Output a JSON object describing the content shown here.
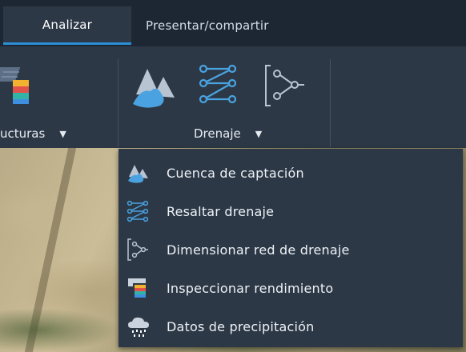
{
  "tabs": [
    {
      "label": "Analizar",
      "active": true
    },
    {
      "label": "Presentar/compartir",
      "active": false
    }
  ],
  "ribbon": {
    "groups": [
      {
        "label": "ucturas",
        "icon": "structures-icon"
      },
      {
        "label": "Drenaje",
        "icon": "drainage-icon"
      }
    ]
  },
  "menu": {
    "items": [
      {
        "label": "Cuenca de captación",
        "icon": "catchment-icon"
      },
      {
        "label": "Resaltar drenaje",
        "icon": "highlight-drainage-icon"
      },
      {
        "label": "Dimensionar red de drenaje",
        "icon": "drainage-network-icon"
      },
      {
        "label": "Inspeccionar rendimiento",
        "icon": "inspect-performance-icon"
      },
      {
        "label": "Datos de precipitación",
        "icon": "rainfall-icon"
      }
    ]
  },
  "colors": {
    "accent": "#2d8fd6",
    "icon_blue": "#4aa3e0",
    "panel": "#2c3846",
    "tabbar": "#1d2734"
  }
}
